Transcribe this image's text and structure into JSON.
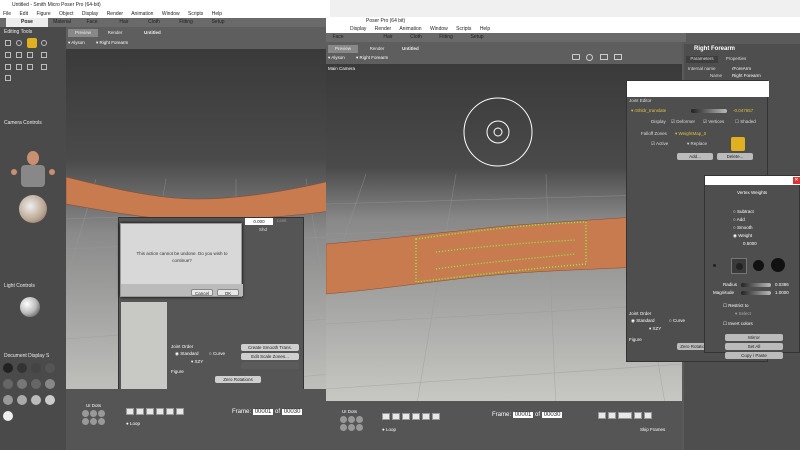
{
  "left_window": {
    "title": "Untitled - Smith Micro Poser Pro (64-bit)",
    "menu": [
      "File",
      "Edit",
      "Figure",
      "Object",
      "Display",
      "Render",
      "Animation",
      "Window",
      "Scripts",
      "Help"
    ],
    "rooms": [
      "Pose",
      "Material",
      "Face",
      "Hair",
      "Cloth",
      "Fitting",
      "Setup"
    ],
    "active_room": "Pose",
    "editing_tools_label": "Editing Tools",
    "camera_controls_label": "Camera Controls",
    "light_controls_label": "Light Controls",
    "document_display_label": "Document Display S",
    "preview_tab": "Preview",
    "render_tab": "Render",
    "doc_title": "Untitled",
    "figure_selector": "Alyson",
    "actor_selector": "Right Forearm",
    "camera_label": "Main Camera",
    "dialog": {
      "message": "This action cannot be undone. Do you wish to continue?",
      "cancel": "Cancel",
      "ok": "OK"
    },
    "behind_dialog": {
      "value": "0.000",
      "unit": "Limit",
      "shd": "Shd",
      "joint_order_label": "Joint Order",
      "standard": "Standard",
      "curve": "Curve",
      "xzy": "XZY",
      "figure_label": "Figure",
      "create_smooth": "Create Smooth Trans.",
      "edit_scale": "Edit Scale Zones...",
      "zero_rotations": "Zero Rotations"
    },
    "ui_dots_label": "UI Dots",
    "loop_label": "Loop",
    "frame_label": "Frame:",
    "frame_value": "00001",
    "frame_of": "of",
    "frame_total": "00030"
  },
  "right_window": {
    "title": "Poser Pro (64 bit)",
    "menu": [
      "Display",
      "Render",
      "Animation",
      "Window",
      "Scripts",
      "Help"
    ],
    "rooms": [
      "Face",
      "Hair",
      "Cloth",
      "Fitting",
      "Setup"
    ],
    "preview_tab": "Preview",
    "render_tab": "Render",
    "doc_title": "Untitled",
    "figure_selector": "Alyson",
    "actor_selector": "Right Forearm",
    "camera_label": "Main Camera",
    "params_panel": {
      "title": "Right Forearm",
      "tab_parameters": "Parameters",
      "tab_properties": "Properties",
      "internal_name_label": "Internal name",
      "internal_name_value": "rForeArm",
      "name_label": "Name",
      "name_value": "Right Forearm"
    },
    "joint_editor": {
      "title": "Joint Editor",
      "param": "rShldr_translate",
      "value": "-0.047557",
      "display_label": "Display",
      "deformer": "Deformer",
      "vertices": "Vertices",
      "shaded": "Shaded",
      "falloff_label": "Falloff Zones",
      "weightmap": "WeightMap_0",
      "active": "Active",
      "replace": "Replace",
      "add_btn": "Add...",
      "delete_btn": "Delete...",
      "joint_order_label": "Joint Order",
      "standard": "Standard",
      "curve": "Curve",
      "xzy": "XZY",
      "figure_label": "Figure",
      "zero_rotations": "Zero Rotations"
    },
    "vertex_weights": {
      "title": "Vertex Weights",
      "modes": [
        "Subtract",
        "Add",
        "Smooth",
        "Weight"
      ],
      "weight_value": "0.5000",
      "radius_label": "Radius",
      "radius_value": "0.0386",
      "magnitude_label": "Magnitude",
      "magnitude_value": "1.0000",
      "restrict_to": "Restrict to",
      "select": "Select",
      "invert_colors": "Invert colors",
      "mirror_btn": "Mirror",
      "set_all_btn": "Set All",
      "copy_paste_btn": "Copy / Paste"
    },
    "ui_dots_label": "UI Dots",
    "loop_label": "Loop",
    "frame_label": "Frame:",
    "frame_value": "00001",
    "frame_of": "of",
    "frame_total": "00030",
    "skip_frames": "Skip Frames"
  }
}
